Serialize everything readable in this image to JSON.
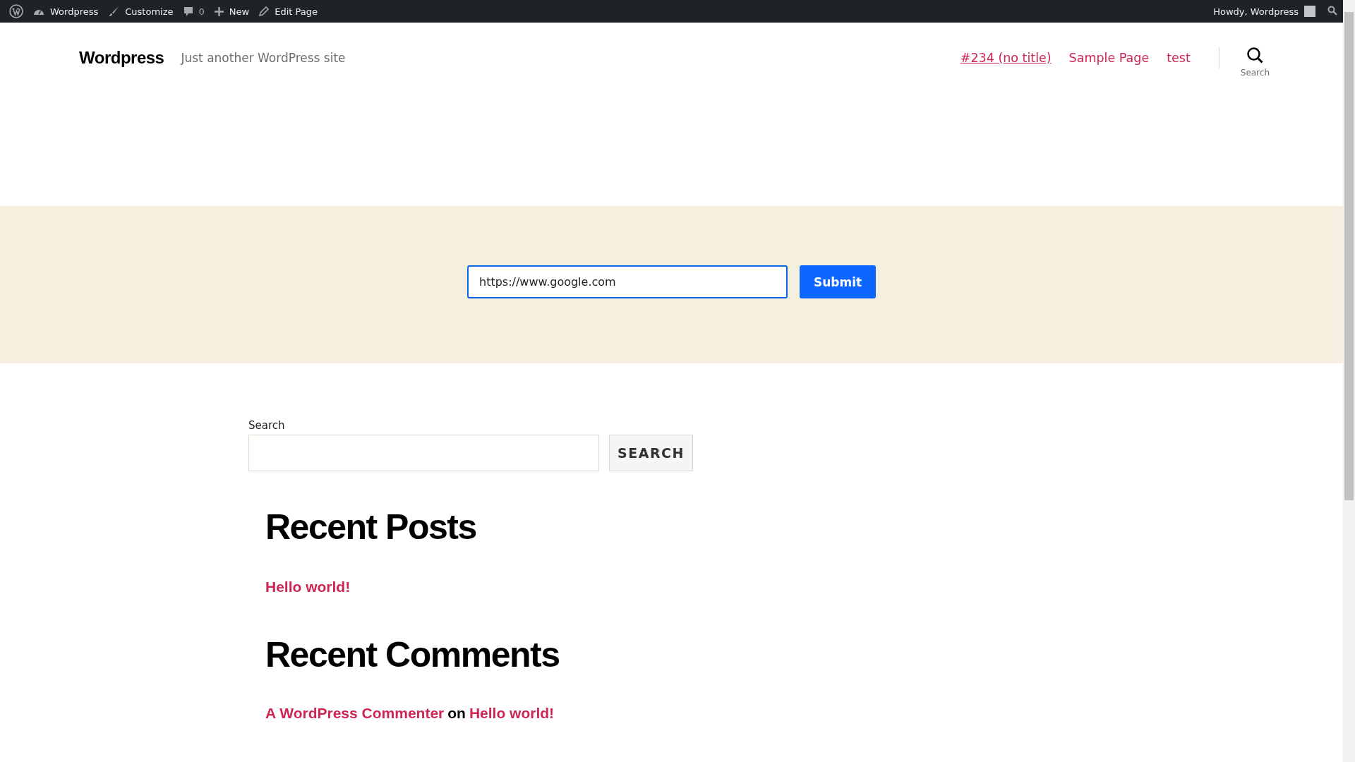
{
  "admin_bar": {
    "items": [
      {
        "kind": "logo"
      },
      {
        "kind": "dashboard",
        "label": "Wordpress"
      },
      {
        "kind": "customize",
        "label": "Customize"
      },
      {
        "kind": "comments",
        "label": "0"
      },
      {
        "kind": "new",
        "label": "New"
      },
      {
        "kind": "edit",
        "label": "Edit Page"
      }
    ],
    "greeting": "Howdy, Wordpress"
  },
  "header": {
    "site_title": "Wordpress",
    "tagline": "Just another WordPress site",
    "nav": [
      {
        "label": "#234 (no title)",
        "selected": true
      },
      {
        "label": "Sample Page",
        "selected": false
      },
      {
        "label": "test",
        "selected": false
      }
    ],
    "search_label": "Search"
  },
  "url_form": {
    "value": "https://www.google.com",
    "button": "Submit"
  },
  "search_widget": {
    "label": "Search",
    "button": "SEARCH"
  },
  "recent_posts": {
    "heading": "Recent Posts",
    "posts": [
      "Hello world!"
    ]
  },
  "recent_comments": {
    "heading": "Recent Comments",
    "comments": [
      {
        "author": "A WordPress Commenter",
        "joiner": "on",
        "post": "Hello world!"
      }
    ]
  }
}
